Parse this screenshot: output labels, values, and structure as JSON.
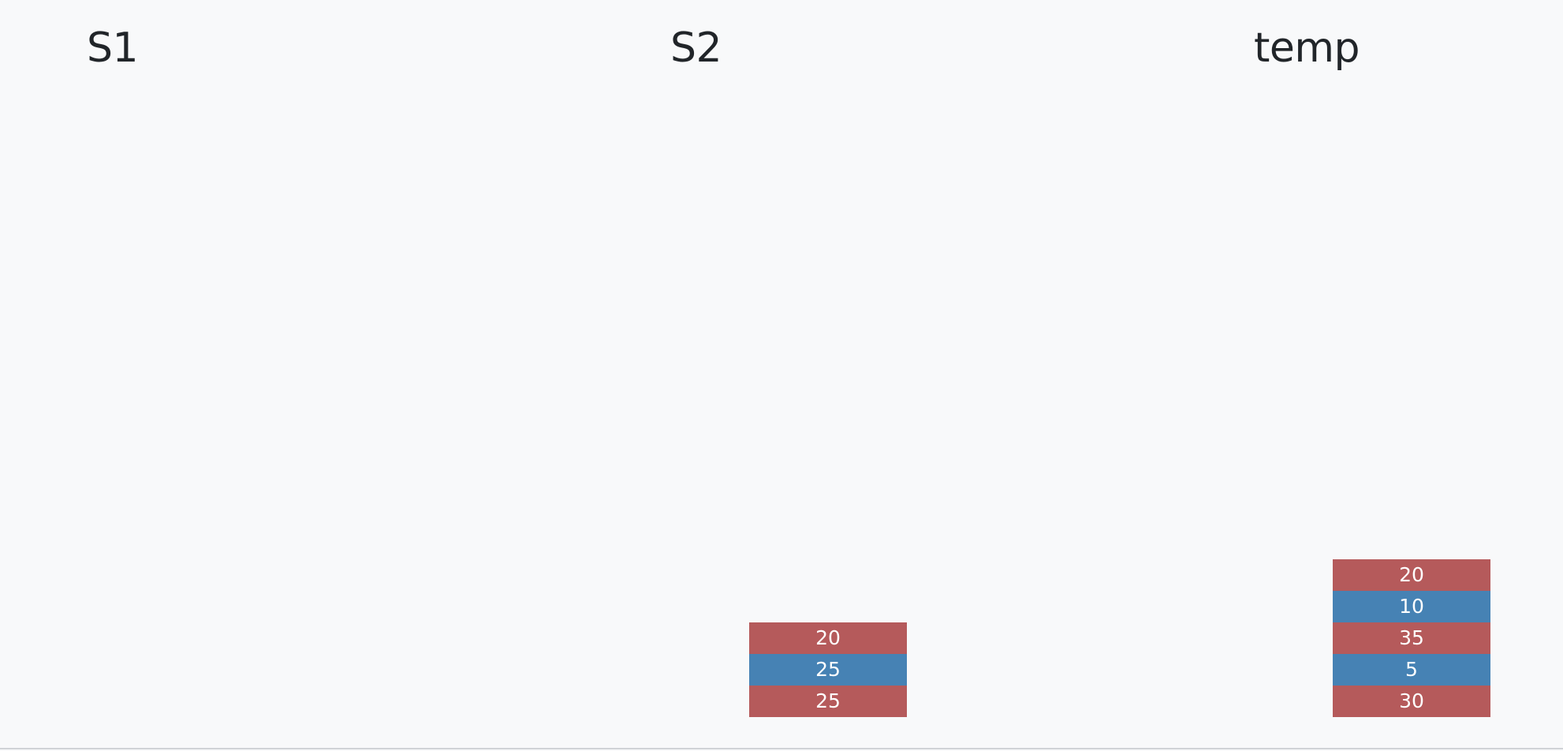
{
  "colors": {
    "background": "#f8f9fa",
    "title": "#212529",
    "red_block": "#b55a5b",
    "blue_block": "#4682b4"
  },
  "stacks": [
    {
      "title": "S1",
      "items": []
    },
    {
      "title": "S2",
      "items": [
        {
          "value": "20",
          "color": "red"
        },
        {
          "value": "25",
          "color": "blue"
        },
        {
          "value": "25",
          "color": "red"
        }
      ]
    },
    {
      "title": "temp",
      "items": [
        {
          "value": "20",
          "color": "red"
        },
        {
          "value": "10",
          "color": "blue"
        },
        {
          "value": "35",
          "color": "red"
        },
        {
          "value": "5",
          "color": "blue"
        },
        {
          "value": "30",
          "color": "red"
        }
      ]
    }
  ]
}
